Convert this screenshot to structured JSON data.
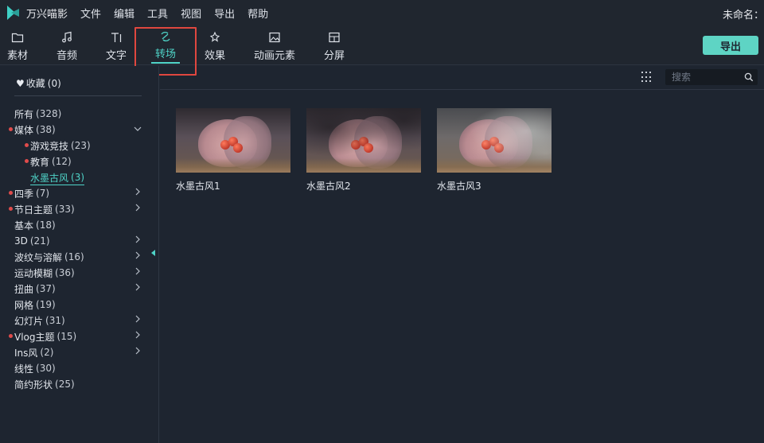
{
  "app": {
    "name": "万兴喵影",
    "document_title": "未命名："
  },
  "menu": [
    "文件",
    "编辑",
    "工具",
    "视图",
    "导出",
    "帮助"
  ],
  "toolbar": {
    "tabs": [
      {
        "label": "素材",
        "icon": "folder-icon"
      },
      {
        "label": "音频",
        "icon": "music-note-icon"
      },
      {
        "label": "文字",
        "icon": "text-icon"
      },
      {
        "label": "转场",
        "icon": "transition-icon",
        "active": true
      },
      {
        "label": "效果",
        "icon": "effects-icon"
      },
      {
        "label": "动画元素",
        "icon": "image-icon"
      },
      {
        "label": "分屏",
        "icon": "split-screen-icon"
      }
    ],
    "export_label": "导出"
  },
  "sidebar": {
    "favorites": {
      "label": "收藏",
      "count": "(0)"
    },
    "categories": [
      {
        "label": "所有",
        "count": "(328)"
      },
      {
        "label": "媒体",
        "count": "(38)",
        "dot": true,
        "expanded": true
      },
      {
        "label": "游戏竞技",
        "count": "(23)",
        "dot": true,
        "sub": true
      },
      {
        "label": "教育",
        "count": "(12)",
        "dot": true,
        "sub": true
      },
      {
        "label": "水墨古风",
        "count": "(3)",
        "sub": true,
        "selected": true
      },
      {
        "label": "四季",
        "count": "(7)",
        "dot": true,
        "chevron": true
      },
      {
        "label": "节日主题",
        "count": "(33)",
        "dot": true,
        "chevron": true
      },
      {
        "label": "基本",
        "count": "(18)"
      },
      {
        "label": "3D",
        "count": "(21)",
        "chevron": true
      },
      {
        "label": "波纹与溶解",
        "count": "(16)",
        "chevron": true
      },
      {
        "label": "运动模糊",
        "count": "(36)",
        "chevron": true
      },
      {
        "label": "扭曲",
        "count": "(37)",
        "chevron": true
      },
      {
        "label": "网格",
        "count": "(19)"
      },
      {
        "label": "幻灯片",
        "count": "(31)",
        "chevron": true
      },
      {
        "label": "Vlog主题",
        "count": "(15)",
        "dot": true,
        "chevron": true
      },
      {
        "label": "Ins风",
        "count": "(2)",
        "chevron": true
      },
      {
        "label": "线性",
        "count": "(30)"
      },
      {
        "label": "简约形状",
        "count": "(25)"
      }
    ]
  },
  "search": {
    "placeholder": "搜索",
    "value": ""
  },
  "items": [
    {
      "name": "水墨古风1"
    },
    {
      "name": "水墨古风2"
    },
    {
      "name": "水墨古风3"
    }
  ],
  "colors": {
    "accent": "#4fd4c8",
    "highlight": "#e0473f",
    "dot": "#e04b4b",
    "background": "#1e2530"
  }
}
